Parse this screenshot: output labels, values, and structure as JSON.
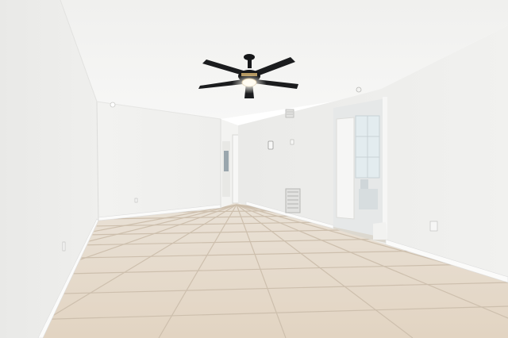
{
  "scene": {
    "subject": "empty-room-interior",
    "palette": {
      "ceiling": "#f4f4f3",
      "left_wall": "#ececea",
      "back_wall": "#f1f1ef",
      "right_wall": "#efefed",
      "floor_tile": "#e3d6c5",
      "grout": "#c9bcab",
      "baseboard": "#fbfbfa",
      "fan_black": "#17181a",
      "fan_brass": "#b79a62",
      "fan_light": "#fff8e6"
    }
  }
}
